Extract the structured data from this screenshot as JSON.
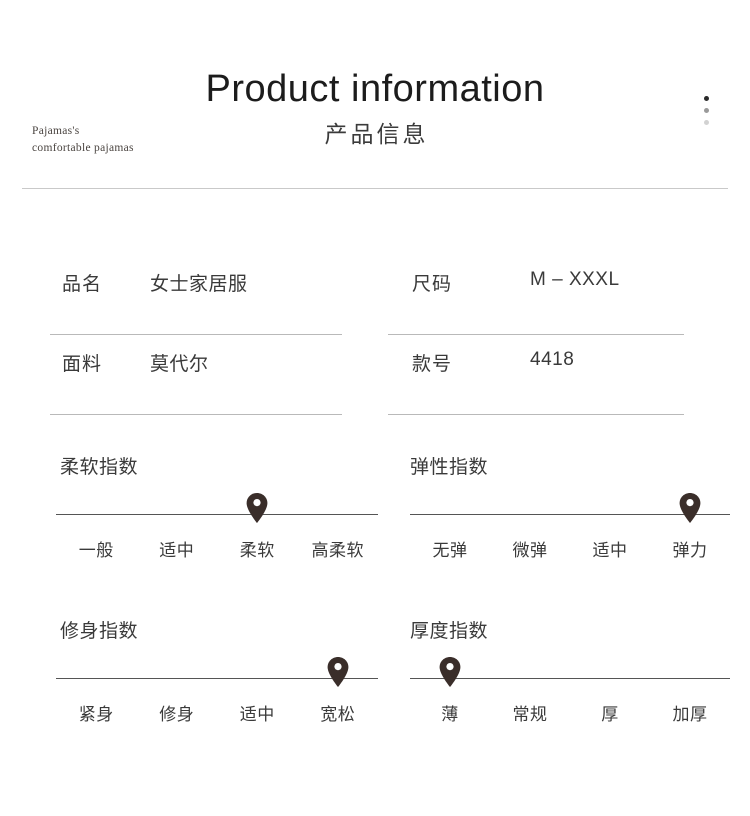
{
  "header": {
    "brand_lines": [
      "Pajamas's",
      "comfortable pajamas"
    ],
    "title_en": "Product information",
    "title_zh": "产品信息",
    "dots_icon": "three-dots-indicator",
    "dot_colors": [
      "#2a2a2a",
      "#9a9a9a",
      "#d2d2d2"
    ]
  },
  "spec_table": {
    "left_rows": [
      {
        "label": "品名",
        "value": "女士家居服"
      },
      {
        "label": "面料",
        "value": "莫代尔"
      }
    ],
    "right_rows": [
      {
        "label": "尺码",
        "value": "M – XXXL"
      },
      {
        "label": "款号",
        "value": "4418"
      }
    ]
  },
  "indices": [
    {
      "title": "柔软指数",
      "labels": [
        "一般",
        "适中",
        "柔软",
        "高柔软"
      ],
      "selected_index": 2,
      "marker_icon": "map-pin-marker",
      "marker_color": "#3a2e2a"
    },
    {
      "title": "弹性指数",
      "labels": [
        "无弹",
        "微弹",
        "适中",
        "弹力"
      ],
      "selected_index": 3,
      "marker_icon": "map-pin-marker",
      "marker_color": "#3a2e2a"
    },
    {
      "title": "修身指数",
      "labels": [
        "紧身",
        "修身",
        "适中",
        "宽松"
      ],
      "selected_index": 3,
      "marker_icon": "map-pin-marker",
      "marker_color": "#3a2e2a"
    },
    {
      "title": "厚度指数",
      "labels": [
        "薄",
        "常规",
        "厚",
        "加厚"
      ],
      "selected_index": 0,
      "marker_icon": "map-pin-marker",
      "marker_color": "#3a2e2a"
    }
  ]
}
